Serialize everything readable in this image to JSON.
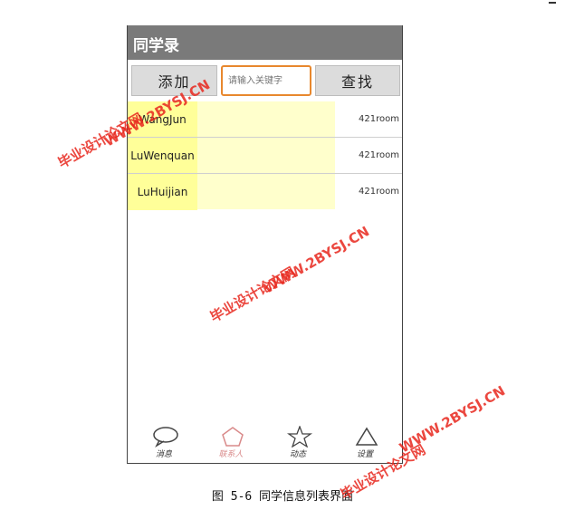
{
  "app": {
    "title": "同学录"
  },
  "toolbar": {
    "add_label": "添加",
    "search_placeholder": "请输入关键字",
    "find_label": "查找"
  },
  "contacts": [
    {
      "name": "WangJun",
      "room": "421room"
    },
    {
      "name": "LuWenquan",
      "room": "421room"
    },
    {
      "name": "LuHuijian",
      "room": "421room"
    }
  ],
  "tabs": [
    {
      "label": "消息",
      "icon": "chat-bubble-icon"
    },
    {
      "label": "联系人",
      "icon": "pentagon-icon",
      "active": true
    },
    {
      "label": "动态",
      "icon": "star-icon"
    },
    {
      "label": "设置",
      "icon": "triangle-icon"
    }
  ],
  "caption": "图 5-6 同学信息列表界面",
  "watermark": {
    "cn": "毕业设计论文网",
    "url": "WWW.2BYSJ.CN"
  },
  "colors": {
    "titlebar": "#7a7a7a",
    "name_cell": "#ffff99",
    "search_border": "#e8882e",
    "active_tab": "#d98a8a",
    "watermark": "#e8281e"
  }
}
